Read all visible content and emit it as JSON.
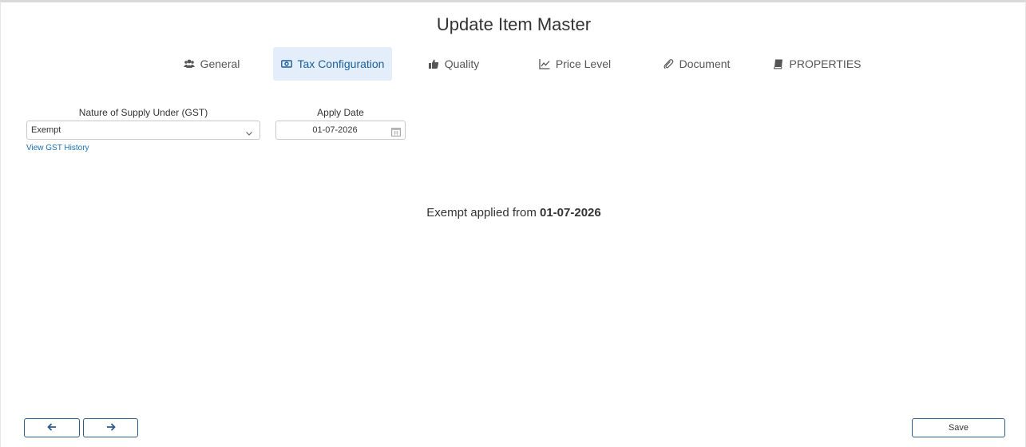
{
  "page": {
    "title": "Update Item Master"
  },
  "tabs": [
    {
      "label": "General",
      "icon": "users-icon",
      "active": false
    },
    {
      "label": "Tax Configuration",
      "icon": "money-icon",
      "active": true
    },
    {
      "label": "Quality",
      "icon": "thumbs-up-icon",
      "active": false
    },
    {
      "label": "Price Level",
      "icon": "line-chart-icon",
      "active": false
    },
    {
      "label": "Document",
      "icon": "paperclip-icon",
      "active": false
    },
    {
      "label": "PROPERTIES",
      "icon": "book-icon",
      "active": false
    }
  ],
  "form": {
    "nature_label": "Nature of Supply Under (GST)",
    "nature_value": "Exempt",
    "apply_date_label": "Apply Date",
    "apply_date_value": "01-07-2026",
    "history_link": "View GST History"
  },
  "summary": {
    "text": "Exempt applied from ",
    "date": "01-07-2026"
  },
  "footer": {
    "prev_icon": "arrow-left-icon",
    "next_icon": "arrow-right-icon",
    "save_label": "Save"
  },
  "colors": {
    "accent": "#1a5f9e",
    "active_tab_bg": "#e3eefa",
    "button_border": "#2b5b8a",
    "link": "#1a6fb4"
  }
}
